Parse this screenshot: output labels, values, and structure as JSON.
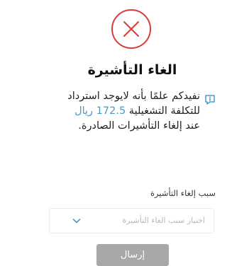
{
  "dialog": {
    "title": "الغاء التأشيرة",
    "message_before": "نفيدكم علمًا بأنه لايوجد استرداد للتكلفة التشغيلية",
    "amount": "172.5 ريال",
    "message_after": "عند إلغاء التأشيرات الصادرة.",
    "reason_label": "سبب إلغاء التأشيرة",
    "reason_placeholder": "اختيار سبب الغاء التأشيرة",
    "submit_label": "إرسال"
  },
  "colors": {
    "error_red": "#d93a3a",
    "link_blue": "#4a9ac9",
    "button_disabled": "#a8a8a8"
  },
  "icons": {
    "status": "close-circle-icon",
    "info": "info-icon",
    "dropdown": "chevron-down-icon"
  }
}
